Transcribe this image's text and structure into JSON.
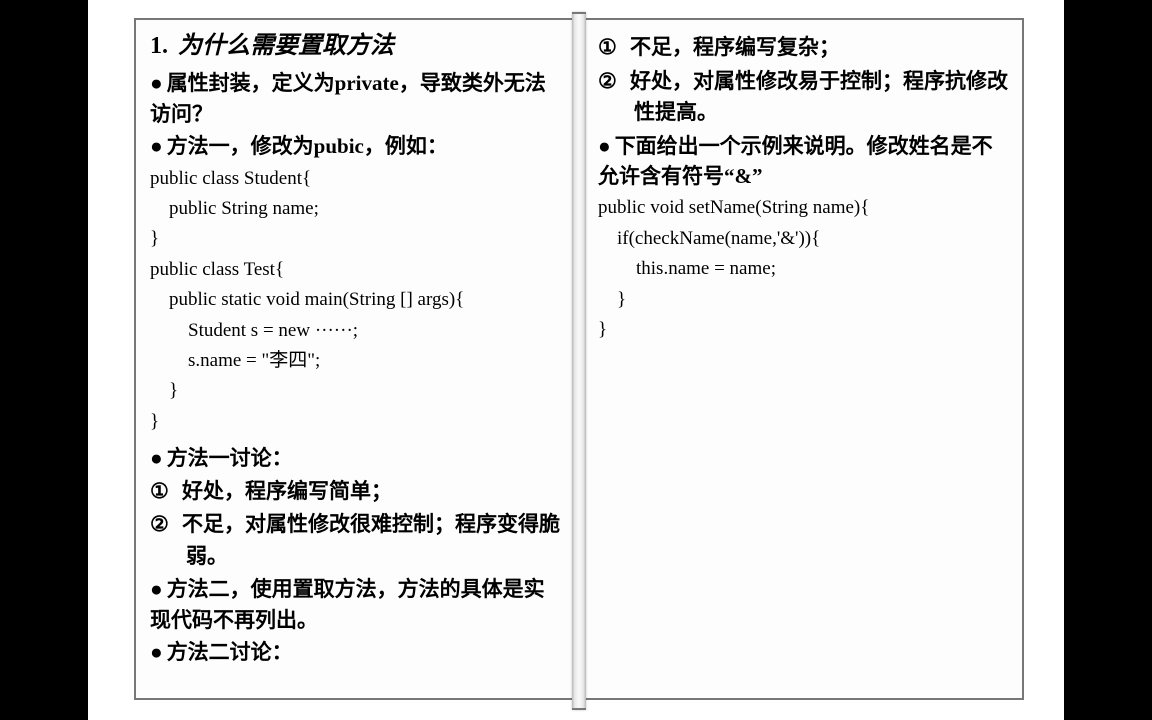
{
  "left": {
    "heading_num": "1.",
    "heading_text": "为什么需要置取方法",
    "b1": "属性封装，定义为private，导致类外无法访问？",
    "b2": "方法一，修改为pubic，例如：",
    "code1": "public class Student{\n    public String name;\n}\npublic class Test{\n    public static void main(String [] args){\n        Student s = new ······;\n        s.name = \"李四\";\n    }\n}",
    "b3": "方法一讨论：",
    "n1": "好处，程序编写简单；",
    "n2": "不足，对属性修改很难控制；程序变得脆弱。",
    "b4": "方法二，使用置取方法，方法的具体是实现代码不再列出。",
    "b5": "方法二讨论："
  },
  "right": {
    "n1": "不足，程序编写复杂；",
    "n2": "好处，对属性修改易于控制；程序抗修改性提高。",
    "b1": "下面给出一个示例来说明。修改姓名是不允许含有符号“&”",
    "code1": "public void setName(String name){\n    if(checkName(name,'&')){\n        this.name = name;\n    }\n}"
  },
  "sym": {
    "dot": "●",
    "c1": "①",
    "c2": "②"
  }
}
